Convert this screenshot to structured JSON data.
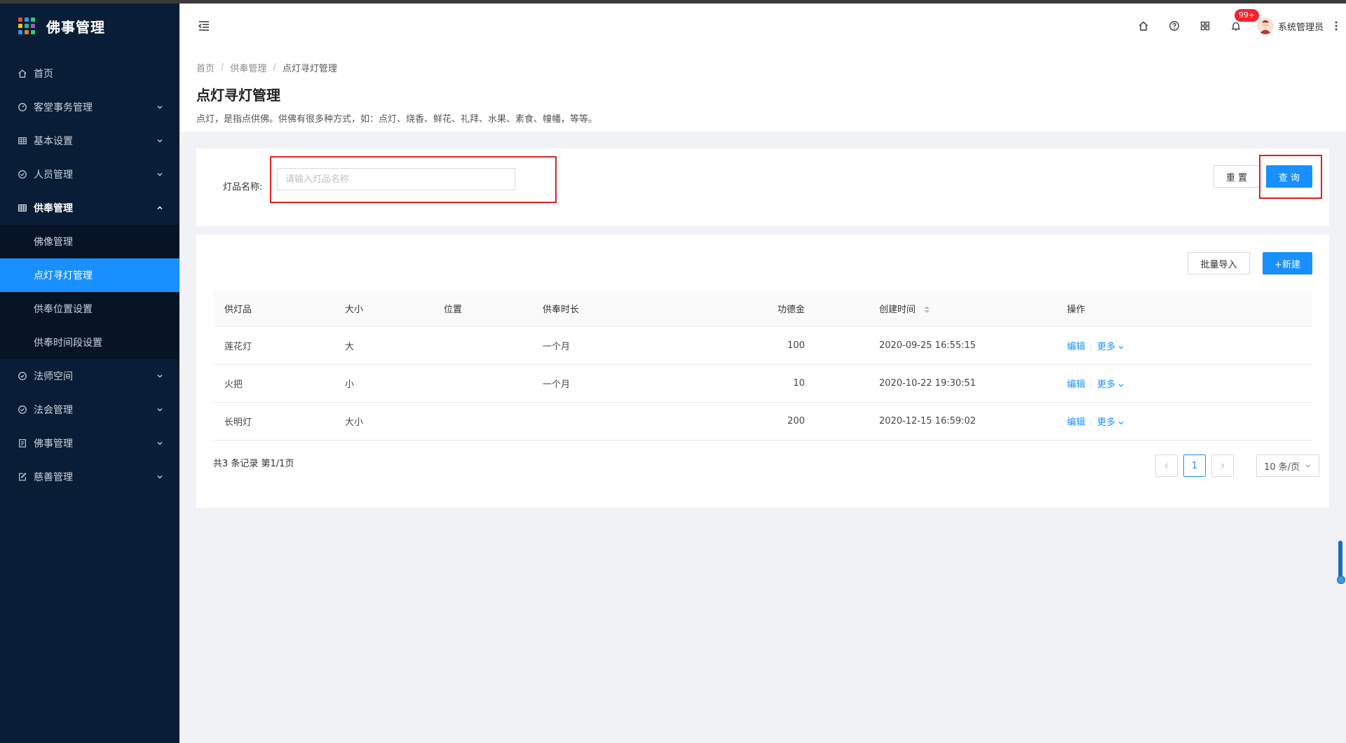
{
  "app": {
    "title": "佛事管理"
  },
  "sidebar": {
    "items": [
      {
        "label": "首页",
        "icon": "home-icon",
        "expandable": false
      },
      {
        "label": "客堂事务管理",
        "icon": "dashboard-icon",
        "expandable": true
      },
      {
        "label": "基本设置",
        "icon": "table-icon",
        "expandable": true
      },
      {
        "label": "人员管理",
        "icon": "check-circle-icon",
        "expandable": true
      },
      {
        "label": "供奉管理",
        "icon": "table-icon",
        "expandable": true,
        "open": true,
        "children": [
          {
            "label": "佛像管理"
          },
          {
            "label": "点灯寻灯管理",
            "active": true
          },
          {
            "label": "供奉位置设置"
          },
          {
            "label": "供奉时间段设置"
          }
        ]
      },
      {
        "label": "法师空间",
        "icon": "check-circle-icon",
        "expandable": true
      },
      {
        "label": "法会管理",
        "icon": "check-circle-icon",
        "expandable": true
      },
      {
        "label": "佛事管理",
        "icon": "profile-icon",
        "expandable": true
      },
      {
        "label": "慈善管理",
        "icon": "form-icon",
        "expandable": true
      }
    ]
  },
  "header": {
    "notification_badge": "99+",
    "user_name": "系统管理员"
  },
  "page": {
    "breadcrumb": [
      "首页",
      "供奉管理",
      "点灯寻灯管理"
    ],
    "title": "点灯寻灯管理",
    "description": "点灯，是指点供佛。供佛有很多种方式，如：点灯、烧香、鲜花、礼拜、水果、素食、幢幡，等等。"
  },
  "search": {
    "label": "灯品名称:",
    "placeholder": "请输入灯品名称",
    "value": "",
    "reset_label": "重 置",
    "query_label": "查 询"
  },
  "toolbar": {
    "import_label": "批量导入",
    "new_label": "+新建"
  },
  "table": {
    "columns": [
      "供灯品",
      "大小",
      "位置",
      "供奉时长",
      "功德金",
      "创建时间",
      "操作"
    ],
    "rows": [
      {
        "name": "莲花灯",
        "size": "大",
        "position": "",
        "duration": "一个月",
        "merit": "100",
        "created": "2020-09-25 16:55:15",
        "edit": "编辑",
        "more": "更多"
      },
      {
        "name": "火把",
        "size": "小",
        "position": "",
        "duration": "一个月",
        "merit": "10",
        "created": "2020-10-22 19:30:51",
        "edit": "编辑",
        "more": "更多"
      },
      {
        "name": "长明灯",
        "size": "大小",
        "position": "",
        "duration": "",
        "merit": "200",
        "created": "2020-12-15 16:59:02",
        "edit": "编辑",
        "more": "更多"
      }
    ]
  },
  "pagination": {
    "summary": "共3 条记录 第1/1页",
    "current_page": "1",
    "page_size": "10 条/页"
  },
  "colors": {
    "sidebar_bg": "#0a1d36",
    "primary": "#1890ff",
    "highlight_box": "#e02020",
    "badge": "#f5222d"
  }
}
